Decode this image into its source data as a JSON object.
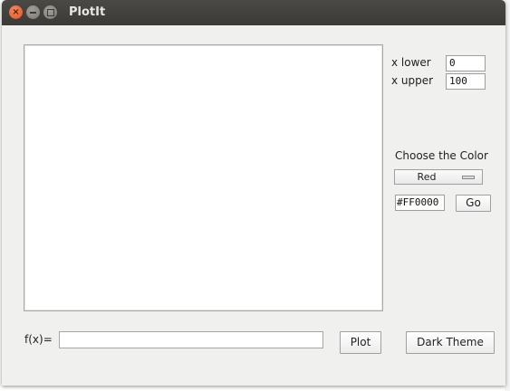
{
  "window": {
    "title": "PlotIt"
  },
  "controls": {
    "x_lower_label": "x lower",
    "x_lower_value": "0",
    "x_upper_label": "x upper",
    "x_upper_value": "100",
    "color_label": "Choose the Color",
    "color_selected": "Red",
    "hex_value": "#FF0000",
    "go_label": "Go"
  },
  "bottom": {
    "fx_label": "f(x)=",
    "fx_value": "",
    "plot_label": "Plot",
    "theme_label": "Dark Theme"
  },
  "colors": {
    "titlebar": "#3c3b37",
    "window_bg": "#f0f0ef",
    "close_button": "#e9562a"
  }
}
